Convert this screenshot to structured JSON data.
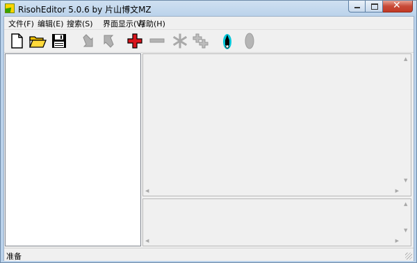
{
  "window": {
    "title": "RisohEditor 5.0.6 by 片山博文MZ",
    "close_glyph": "✕"
  },
  "menu": {
    "items": [
      {
        "label": "文件(F)"
      },
      {
        "label": "编辑(E)"
      },
      {
        "label": "搜索(S)"
      },
      {
        "label": "界面显示(V)"
      },
      {
        "label": "帮助(H)"
      }
    ]
  },
  "toolbar": {
    "buttons": [
      {
        "icon": "new-file-icon"
      },
      {
        "icon": "open-folder-icon"
      },
      {
        "icon": "save-floppy-icon"
      },
      {
        "icon": "move-down-arrow-icon"
      },
      {
        "icon": "move-up-arrow-icon"
      },
      {
        "icon": "add-plus-icon"
      },
      {
        "icon": "delete-minus-icon"
      },
      {
        "icon": "asterisk-icon"
      },
      {
        "icon": "clone-icon"
      },
      {
        "icon": "compile-rocket-icon"
      },
      {
        "icon": "ellipse-icon"
      }
    ]
  },
  "colors": {
    "add_red": "#d8141b",
    "disabled_gray": "#a9a9a9",
    "rocket_cyan": "#00c6d8"
  },
  "statusbar": {
    "text": "准备"
  }
}
